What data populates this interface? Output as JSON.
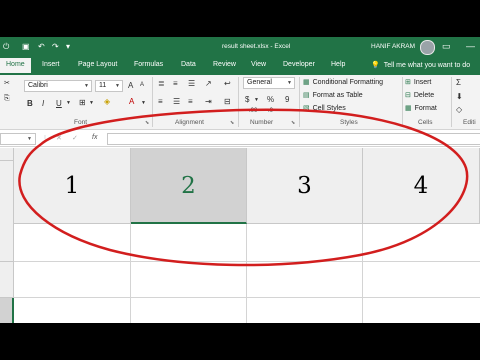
{
  "titlebar": {
    "qat": {
      "autosave_icon": "autosave-icon",
      "save_icon": "save-icon",
      "undo_icon": "undo-icon",
      "redo_icon": "redo-icon",
      "customize_icon": "customize-qat-icon"
    },
    "file_title": "result sheet.xlsx  -  Excel",
    "user_name": "HANIF AKRAM",
    "ribbon_display_icon": "ribbon-display-options-icon",
    "minimize_icon": "minimize-icon",
    "color": "#217346"
  },
  "tabs": [
    "Home",
    "Insert",
    "Page Layout",
    "Formulas",
    "Data",
    "Review",
    "View",
    "Developer",
    "Help"
  ],
  "active_tab": "Home",
  "tell_me": "Tell me what you want to do",
  "ribbon": {
    "font_name": "Calibri",
    "font_size": "11",
    "number_format": "General",
    "bold": "B",
    "italic": "I",
    "underline": "U",
    "currency": "$",
    "percent": "%",
    "comma": "9",
    "conditional_formatting": "Conditional Formatting",
    "format_as_table": "Format as Table",
    "cell_styles": "Cell Styles",
    "insert": "Insert",
    "delete": "Delete",
    "format": "Format",
    "groups": {
      "font": "Font",
      "alignment": "Alignment",
      "number": "Number",
      "styles": "Styles",
      "cells": "Cells",
      "editing": "Editi"
    }
  },
  "formula_bar": {
    "cancel_glyph": "✕",
    "enter_glyph": "✓",
    "fx": "fx"
  },
  "columns": [
    {
      "label": "1",
      "selected": false
    },
    {
      "label": "2",
      "selected": true
    },
    {
      "label": "3",
      "selected": false
    },
    {
      "label": "4",
      "selected": false
    }
  ],
  "accent_color": "#217346",
  "annotation_color": "#d21e1e"
}
